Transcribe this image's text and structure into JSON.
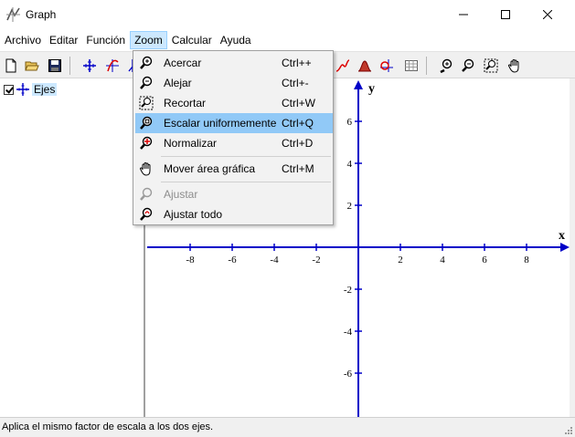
{
  "window": {
    "title": "Graph",
    "minimize_glyph": "—",
    "close_glyph": "✕"
  },
  "menubar": {
    "items": [
      "Archivo",
      "Editar",
      "Función",
      "Zoom",
      "Calcular",
      "Ayuda"
    ],
    "active": "Zoom"
  },
  "tree": {
    "items": [
      {
        "label": "Ejes",
        "checked": true
      }
    ]
  },
  "zoom_menu": {
    "items": [
      {
        "label": "Acercar",
        "shortcut": "Ctrl++",
        "icon": "zoom-in-icon",
        "enabled": true
      },
      {
        "label": "Alejar",
        "shortcut": "Ctrl+-",
        "icon": "zoom-out-icon",
        "enabled": true
      },
      {
        "label": "Recortar",
        "shortcut": "Ctrl+W",
        "icon": "zoom-window-icon",
        "enabled": true
      },
      {
        "label": "Escalar uniformemente",
        "shortcut": "Ctrl+Q",
        "icon": "zoom-square-icon",
        "enabled": true,
        "highlighted": true
      },
      {
        "label": "Normalizar",
        "shortcut": "Ctrl+D",
        "icon": "zoom-standard-icon",
        "enabled": true
      },
      {
        "label": "Mover área gráfica",
        "shortcut": "Ctrl+M",
        "icon": "hand-icon",
        "enabled": true
      },
      {
        "label": "Ajustar",
        "shortcut": "",
        "icon": "zoom-fit-icon",
        "enabled": false
      },
      {
        "label": "Ajustar todo",
        "shortcut": "",
        "icon": "zoom-fit-all-icon",
        "enabled": true
      }
    ]
  },
  "axes": {
    "x_label": "x",
    "y_label": "y",
    "x_ticks": [
      "-8",
      "-6",
      "-4",
      "-2",
      "2",
      "4",
      "6",
      "8"
    ],
    "y_ticks": [
      "6",
      "4",
      "2",
      "-2",
      "-4",
      "-6"
    ],
    "axis_color": "#0000c8"
  },
  "statusbar": {
    "text": "Aplica el mismo factor de escala a los dos ejes."
  },
  "colors": {
    "menu_highlight": "#91c9f7",
    "menu_active": "#cce8ff"
  }
}
